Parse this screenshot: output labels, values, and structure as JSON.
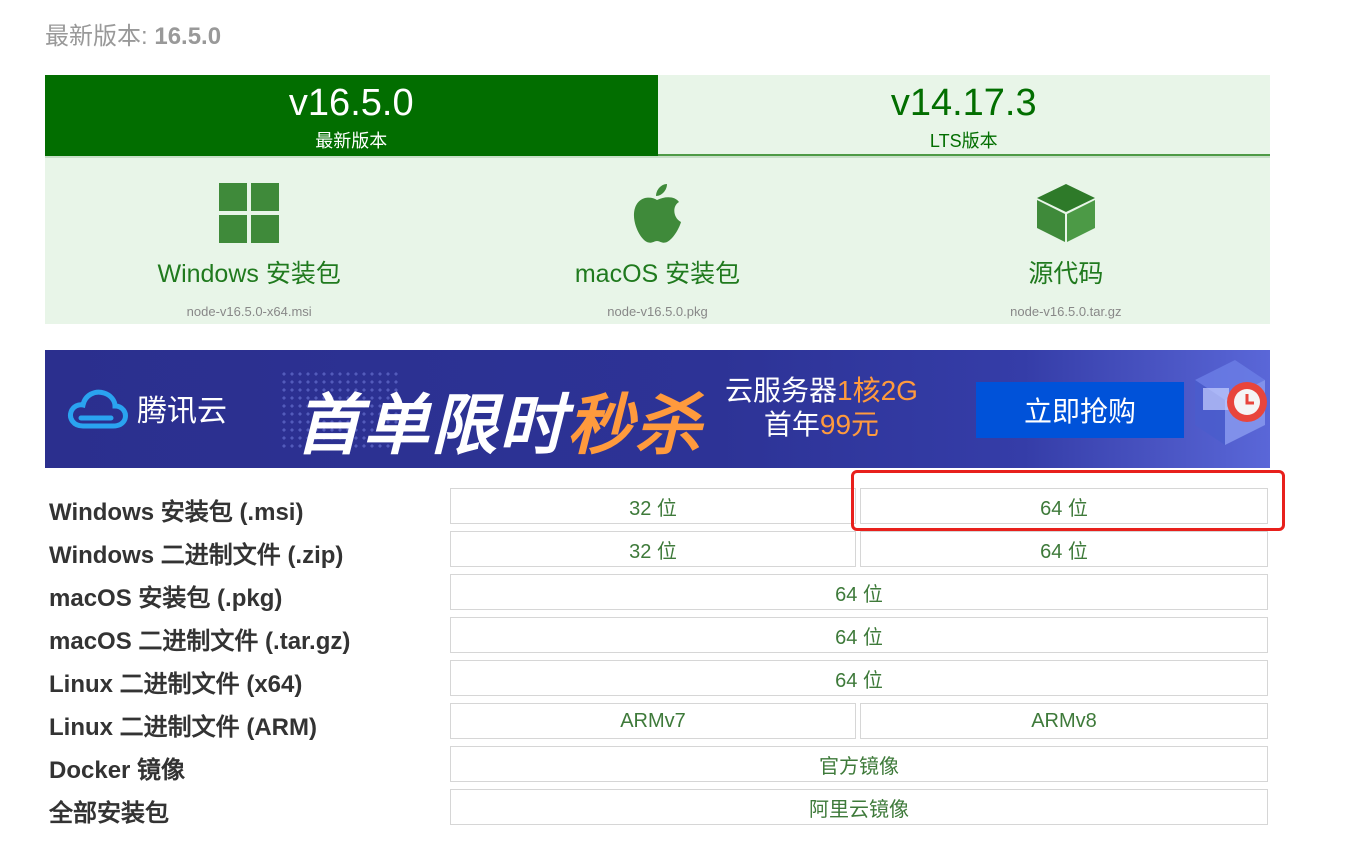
{
  "latest": {
    "prefix": "最新版本: ",
    "version": "16.5.0"
  },
  "tabs": [
    {
      "version": "v16.5.0",
      "sub": "最新版本"
    },
    {
      "version": "v14.17.3",
      "sub": "LTS版本"
    }
  ],
  "downloads": [
    {
      "icon": "windows-icon",
      "label": "Windows 安装包",
      "file": "node-v16.5.0-x64.msi"
    },
    {
      "icon": "apple-icon",
      "label": "macOS 安装包",
      "file": "node-v16.5.0.pkg"
    },
    {
      "icon": "box-icon",
      "label": "源代码",
      "file": "node-v16.5.0.tar.gz"
    }
  ],
  "banner": {
    "brand": "腾讯云",
    "headline_white": "首单限时",
    "headline_orange": "秒杀",
    "offer_line1_white": "云服务器",
    "offer_line1_orange": "1核2G",
    "offer_line2_white": "首年",
    "offer_line2_orange": "99元",
    "button": "立即抢购",
    "colors": {
      "bg": "#2b2f8e",
      "accent": "#ff9a3d",
      "button": "#0052d9"
    }
  },
  "rows": [
    {
      "label": "Windows 安装包 (.msi)",
      "cells": [
        "32 位",
        "64 位"
      ]
    },
    {
      "label": "Windows 二进制文件 (.zip)",
      "cells": [
        "32 位",
        "64 位"
      ]
    },
    {
      "label": "macOS 安装包 (.pkg)",
      "cells": [
        "64 位"
      ]
    },
    {
      "label": "macOS 二进制文件 (.tar.gz)",
      "cells": [
        "64 位"
      ]
    },
    {
      "label": "Linux 二进制文件 (x64)",
      "cells": [
        "64 位"
      ]
    },
    {
      "label": "Linux 二进制文件 (ARM)",
      "cells": [
        "ARMv7",
        "ARMv8"
      ]
    },
    {
      "label": "Docker 镜像",
      "cells": [
        "官方镜像"
      ]
    },
    {
      "label": "全部安装包",
      "cells": [
        "阿里云镜像"
      ]
    }
  ],
  "colors": {
    "brand_green": "#026e00",
    "light_green": "#e8f5e8",
    "highlight": "#e8201c"
  }
}
